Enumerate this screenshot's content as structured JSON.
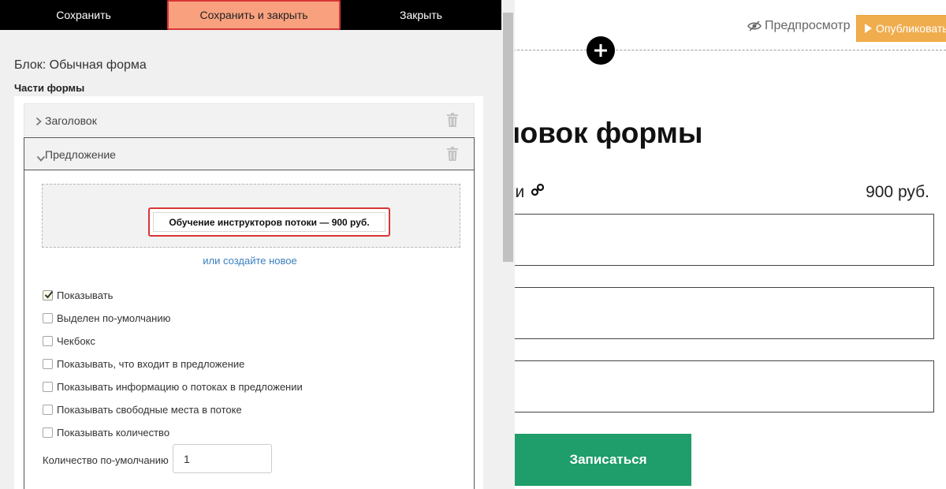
{
  "toolbar": {
    "save_label": "Сохранить",
    "save_close_label": "Сохранить и закрыть",
    "close_label": "Закрыть"
  },
  "editor": {
    "block_title": "Блок: Обычная форма",
    "parts_label": "Части формы",
    "parts": [
      {
        "label": "Заголовок",
        "expanded": false
      },
      {
        "label": "Предложение",
        "expanded": true
      }
    ],
    "offer_card_text": "Обучение инструкторов потоки — 900 руб.",
    "create_new_link": "или создайте новое",
    "options": [
      {
        "label": "Показывать",
        "checked": true
      },
      {
        "label": "Выделен по-умолчанию",
        "checked": false
      },
      {
        "label": "Чекбокс",
        "checked": false
      },
      {
        "label": "Показывать, что входит в предложение",
        "checked": false
      },
      {
        "label": "Показывать информацию о потоках в предложении",
        "checked": false
      },
      {
        "label": "Показывать свободные места в потоке",
        "checked": false
      },
      {
        "label": "Показывать количество",
        "checked": false
      }
    ],
    "default_qty_label": "Количество по-умолчанию",
    "default_qty_value": "1"
  },
  "preview": {
    "preview_link": "Предпросмотр",
    "publish_label": "Опубликовать",
    "form_title": "головок формы",
    "offer_name": "отоки",
    "offer_price": "900 руб.",
    "submit_label": "Записаться"
  },
  "colors": {
    "toolbar_bg": "#000000",
    "active_button": "#f9a17f",
    "highlight_border": "#d93535",
    "publish": "#f0ad4e",
    "submit": "#1f9d6a",
    "link": "#3a7fbf"
  },
  "icons": {
    "preview": "eye-slash-icon",
    "publish": "play-icon",
    "add": "plus-circle-icon",
    "offer_link": "chain-link-icon",
    "collapsed": "chevron-right-icon",
    "expanded": "chevron-down-icon",
    "delete": "trash-icon",
    "checked": "checkmark-icon"
  }
}
